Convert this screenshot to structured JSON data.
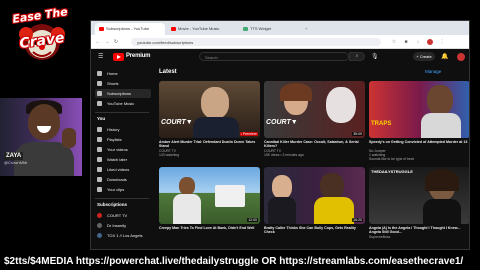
{
  "overlay": {
    "logo_line1": "Ease The",
    "logo_line2": "Crave",
    "cam_name": "ZAYA",
    "cam_handle": "@CrownMMr",
    "banner_text": "$2tts/$4MEDIA https://powerchat.live/thedailystruggle OR https://streamlabs.com/easethecrave1/"
  },
  "browser": {
    "tabs": [
      {
        "label": "Subscriptions - YouTube"
      },
      {
        "label": "Movie - YouTube Music"
      },
      {
        "label": "TTS Widget"
      }
    ],
    "address": "youtube.com/feed/subscriptions"
  },
  "youtube": {
    "brand": "Premium",
    "search_placeholder": "Search",
    "create_label": "+ Create",
    "colors": {
      "accent": "#ff0000",
      "link": "#3ea6ff",
      "background": "#0f0f0f"
    },
    "sidebar": {
      "top": [
        {
          "label": "Home",
          "icon": "home-icon"
        },
        {
          "label": "Shorts",
          "icon": "shorts-icon"
        },
        {
          "label": "Subscriptions",
          "icon": "subscriptions-icon",
          "active": true
        },
        {
          "label": "YouTube Music",
          "icon": "music-icon"
        }
      ],
      "you_header": "You",
      "you": [
        {
          "label": "History",
          "icon": "history-icon"
        },
        {
          "label": "Playlists",
          "icon": "playlists-icon"
        },
        {
          "label": "Your videos",
          "icon": "your-videos-icon"
        },
        {
          "label": "Watch later",
          "icon": "watch-later-icon"
        },
        {
          "label": "Liked videos",
          "icon": "liked-icon"
        },
        {
          "label": "Downloads",
          "icon": "downloads-icon"
        },
        {
          "label": "Your clips",
          "icon": "clips-icon"
        }
      ],
      "subs_header": "Subscriptions",
      "subs": [
        {
          "label": "COURT TV"
        },
        {
          "label": "Dr Insanity"
        },
        {
          "label": "TOX 1 // Los Angels"
        }
      ]
    },
    "main": {
      "heading": "Latest",
      "manage": "Manage",
      "videos": [
        {
          "title": "Amber Alert Murder Trial: Defendant Dustin Duren Takes Stand",
          "channel": "COURT TV",
          "meta": "143 watching",
          "duration": "• Premiere"
        },
        {
          "title": "Cannibal Killer Murder Case: Occult, Satanism, & Serial Killers?",
          "channel": "COURT TV",
          "meta": "15K views • 3 minutes ago",
          "duration": "35:09"
        },
        {
          "title": "Speedy's on Getting Convicted of Attempted Murder at 13",
          "channel": "No Jumper",
          "meta": "1 watching",
          "duration": "",
          "extra": "Sounds like to be type of beat"
        },
        {
          "title": "Creepy Man Tries To Find Love At Bank, Didn't End Well",
          "channel": "",
          "meta": "",
          "duration": "12:00"
        },
        {
          "title": "Bratty Caller Thinks She Can Bully Cops, Gets Reality Check",
          "channel": "",
          "meta": "",
          "duration": "16:20"
        },
        {
          "title": "Angela (A) Is the Angela I Thought I Thought I Knew... Angela Still Good...",
          "channel": "SupremeBoss",
          "meta": "",
          "duration": "",
          "extra": "THEDAILYSTRUGGLE"
        }
      ]
    }
  }
}
